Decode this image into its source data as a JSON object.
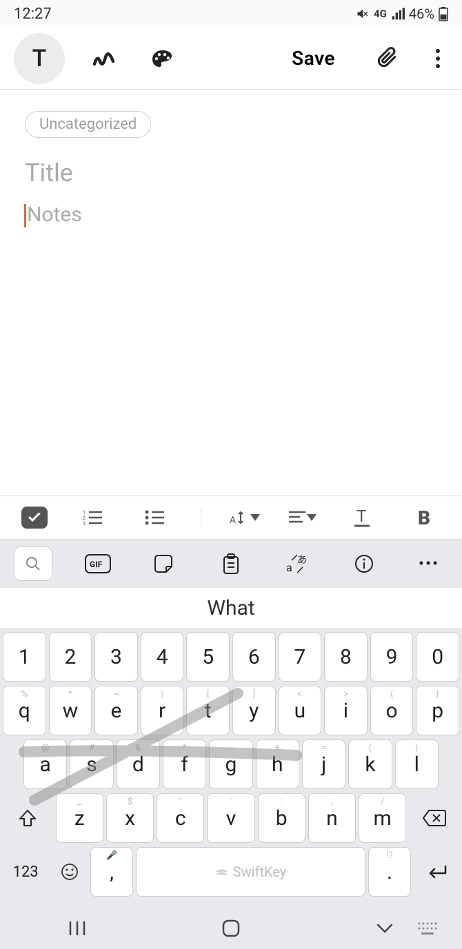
{
  "status": {
    "time": "12:27",
    "network": "4G",
    "battery": "46%"
  },
  "toolbar": {
    "text_tool": "T",
    "save": "Save"
  },
  "editor": {
    "chip": "Uncategorized",
    "title_placeholder": "Title",
    "notes_placeholder": "Notes"
  },
  "format": {
    "bold": "B"
  },
  "kbtop": {
    "gif": "GIF"
  },
  "suggestion": "What",
  "keys": {
    "r1": [
      "1",
      "2",
      "3",
      "4",
      "5",
      "6",
      "7",
      "8",
      "9",
      "0"
    ],
    "r2": [
      "q",
      "w",
      "e",
      "r",
      "t",
      "y",
      "u",
      "i",
      "o",
      "p"
    ],
    "r2alt": [
      "%",
      "^",
      "~",
      "|",
      "[",
      "]",
      "<",
      ">",
      "{",
      "}"
    ],
    "r3": [
      "a",
      "s",
      "d",
      "f",
      "g",
      "h",
      "j",
      "k",
      "l"
    ],
    "r3alt": [
      "@",
      "#",
      "&",
      "*",
      "-",
      "+",
      "=",
      "(",
      ")"
    ],
    "r4": [
      "z",
      "x",
      "c",
      "v",
      "b",
      "n",
      "m"
    ],
    "r4alt": [
      "_",
      "$",
      "\"",
      "'",
      ":",
      ";",
      "/"
    ],
    "numkey": "123",
    "comma": ",",
    "space": "SwiftKey",
    "period": ".",
    "period_alt": "!?"
  }
}
